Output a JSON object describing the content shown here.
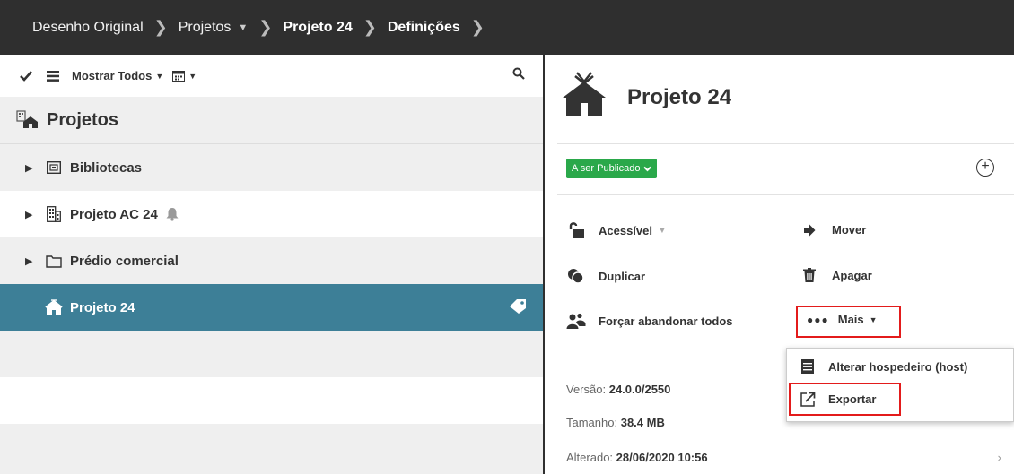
{
  "breadcrumb": {
    "items": [
      "Desenho Original",
      "Projetos",
      "Projeto 24",
      "Definições"
    ]
  },
  "toolbar": {
    "show_all_label": "Mostrar Todos"
  },
  "tree": {
    "header": "Projetos",
    "items": [
      {
        "label": "Bibliotecas"
      },
      {
        "label": "Projeto AC 24"
      },
      {
        "label": "Prédio comercial"
      },
      {
        "label": "Projeto 24"
      }
    ]
  },
  "detail": {
    "title": "Projeto 24",
    "status": "A ser Publicado",
    "actions": {
      "accessible": "Acessível",
      "move": "Mover",
      "duplicate": "Duplicar",
      "delete": "Apagar",
      "force_leave": "Forçar abandonar todos",
      "more": "Mais"
    },
    "info": {
      "version_label": "Versão:",
      "version_value": "24.0.0/2550",
      "size_label": "Tamanho:",
      "size_value": "38.4 MB",
      "changed_label": "Alterado:",
      "changed_value": "28/06/2020 10:56"
    }
  },
  "dropdown": {
    "change_host": "Alterar hospedeiro (host)",
    "export": "Exportar"
  },
  "colors": {
    "topbar": "#2f2f2f",
    "selected_row": "#3d7f97",
    "status_green": "#2aa84a",
    "highlight_red": "#e31b1b"
  }
}
